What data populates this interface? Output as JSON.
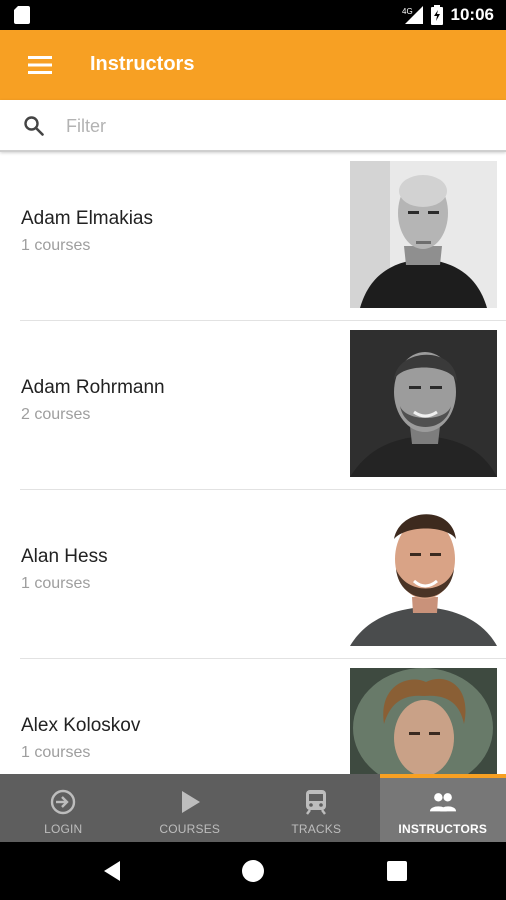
{
  "status_bar": {
    "time": "10:06",
    "network": "4G",
    "icons": [
      "sd-card-icon",
      "signal-icon",
      "battery-icon"
    ]
  },
  "app_bar": {
    "title": "Instructors",
    "menu_icon": "hamburger-menu-icon"
  },
  "filter": {
    "placeholder": "Filter",
    "value": "",
    "icon": "search-icon"
  },
  "instructors": [
    {
      "name": "Adam Elmakias",
      "courses": "1 courses"
    },
    {
      "name": "Adam Rohrmann",
      "courses": "2 courses"
    },
    {
      "name": "Alan Hess",
      "courses": "1 courses"
    },
    {
      "name": "Alex Koloskov",
      "courses": "1 courses"
    }
  ],
  "bottom_nav": {
    "items": [
      {
        "label": "LOGIN",
        "icon": "login-icon",
        "active": false
      },
      {
        "label": "COURSES",
        "icon": "play-icon",
        "active": false
      },
      {
        "label": "TRACKS",
        "icon": "train-icon",
        "active": false
      },
      {
        "label": "INSTRUCTORS",
        "icon": "people-icon",
        "active": true
      }
    ]
  },
  "colors": {
    "accent": "#f7a023",
    "nav_bg": "#5e5e5e",
    "nav_active_bg": "#777777",
    "text_primary": "#222222",
    "text_secondary": "#9e9e9e"
  }
}
